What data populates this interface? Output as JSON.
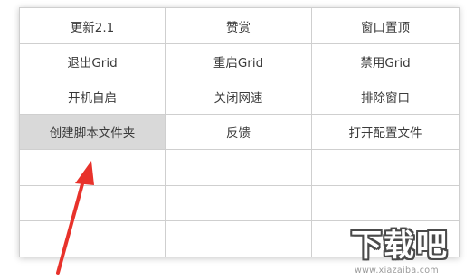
{
  "menu": {
    "rows": [
      [
        "更新2.1",
        "赞赏",
        "窗口置顶"
      ],
      [
        "退出Grid",
        "重启Grid",
        "禁用Grid"
      ],
      [
        "开机自启",
        "关闭网速",
        "排除窗口"
      ],
      [
        "创建脚本文件夹",
        "反馈",
        "打开配置文件"
      ],
      [
        "",
        "",
        ""
      ],
      [
        "",
        "",
        ""
      ],
      [
        "",
        "",
        ""
      ]
    ],
    "highlighted": "创建脚本文件夹"
  },
  "annotation": {
    "arrow_color": "#e8322b"
  },
  "watermark": {
    "brand": "下载吧",
    "url": "www.xiazaiba.com"
  }
}
